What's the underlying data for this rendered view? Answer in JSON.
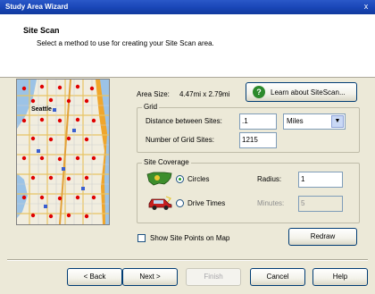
{
  "window": {
    "title": "Study Area Wizard",
    "close_glyph": "x"
  },
  "header": {
    "title": "Site Scan",
    "subtitle": "Select a method to use for creating your Site Scan area."
  },
  "map": {
    "city_label": "Seattle"
  },
  "area": {
    "label": "Area Size:",
    "value": "4.47mi x 2.79mi"
  },
  "learn_button": {
    "label": "Learn about SiteScan..."
  },
  "grid": {
    "title": "Grid",
    "distance_label": "Distance between Sites:",
    "distance_value": ".1",
    "units_value": "Miles",
    "count_label": "Number of Grid Sites:",
    "count_value": "1215"
  },
  "coverage": {
    "title": "Site Coverage",
    "circles_label": "Circles",
    "circles_selected": true,
    "radius_label": "Radius:",
    "radius_value": "1",
    "drive_label": "Drive Times",
    "minutes_label": "Minutes:",
    "minutes_value": "5"
  },
  "show_points": {
    "label": "Show Site Points on Map",
    "checked": false
  },
  "redraw_button": {
    "label": "Redraw"
  },
  "footer": {
    "back": "< Back",
    "next": "Next >",
    "finish": "Finish",
    "cancel": "Cancel",
    "help": "Help"
  },
  "colors": {
    "title_bar": "#1A47B8",
    "map_point": "#E00000",
    "accent_green": "#2C8A2C"
  }
}
